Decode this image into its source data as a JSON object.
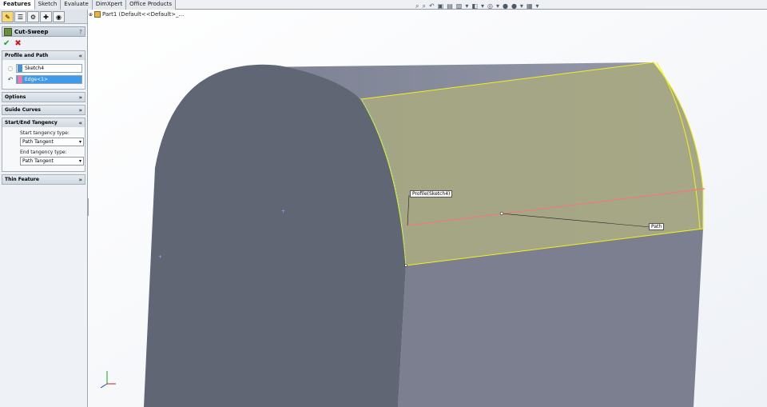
{
  "command_tabs": [
    {
      "label": "Features",
      "active": true
    },
    {
      "label": "Sketch",
      "active": false
    },
    {
      "label": "Evaluate",
      "active": false
    },
    {
      "label": "DimXpert",
      "active": false
    },
    {
      "label": "Office Products",
      "active": false
    }
  ],
  "manager_tabs": [
    {
      "icon": "feature-manager-icon",
      "active": true
    },
    {
      "icon": "property-manager-icon",
      "active": false
    },
    {
      "icon": "configuration-manager-icon",
      "active": false
    },
    {
      "icon": "dimxpert-manager-icon",
      "active": false
    },
    {
      "icon": "display-manager-icon",
      "active": false
    }
  ],
  "property_manager": {
    "title": "Cut-Sweep",
    "help": "?",
    "ok": "✔",
    "cancel": "✖",
    "profile_and_path": {
      "header": "Profile and Path",
      "profile_value": "Sketch4",
      "path_value": "Edge<1>"
    },
    "options": {
      "header": "Options"
    },
    "guide_curves": {
      "header": "Guide Curves"
    },
    "tangency": {
      "header": "Start/End Tangency",
      "start_label": "Start tangency type:",
      "start_value": "Path Tangent",
      "end_label": "End tangency type:",
      "end_value": "Path Tangent"
    },
    "thin_feature": {
      "header": "Thin Feature"
    }
  },
  "tree_crumb": {
    "expand": "⊕",
    "text": "Part1  (Default<<Default>_..."
  },
  "callouts": {
    "profile": "Profile(Sketch4)",
    "path": "Path"
  },
  "colors": {
    "body_dark": "#616674",
    "body_side": "#7d8192",
    "body_top": "#8b8fa1",
    "sweep_fill": "#a7a882",
    "sweep_edge": "#f2f21a",
    "path_line": "#f07a7a"
  }
}
